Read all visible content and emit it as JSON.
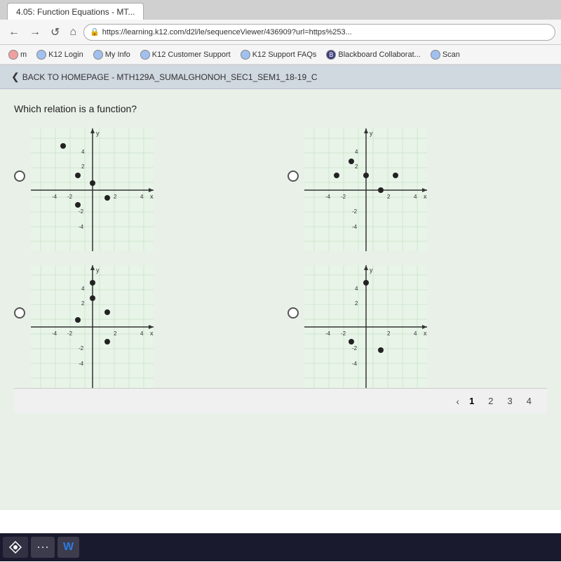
{
  "browser": {
    "tab_label": "4.05: Function Equations - MT...",
    "url": "https://learning.k12.com/d2l/le/sequenceViewer/436909?url=https%253...",
    "nav_back": "←",
    "nav_forward": "→",
    "nav_reload": "↺",
    "nav_home": "⌂"
  },
  "bookmarks": [
    {
      "label": "m",
      "icon": "K12"
    },
    {
      "label": "K12 Login",
      "icon": "K"
    },
    {
      "label": "My Info",
      "icon": "K"
    },
    {
      "label": "K12 Customer Support",
      "icon": "K"
    },
    {
      "label": "K12 Support FAQs",
      "icon": "K"
    },
    {
      "label": "Blackboard Collaborat...",
      "icon": "B"
    },
    {
      "label": "Scan",
      "icon": "K"
    }
  ],
  "breadcrumb": "BACK TO HOMEPAGE - MTH129A_SUMALGHONOH_SEC1_SEM1_18-19_C",
  "question": {
    "text": "Which relation is a function?",
    "options": [
      {
        "id": "A",
        "selected": false
      },
      {
        "id": "B",
        "selected": false
      },
      {
        "id": "C",
        "selected": false
      },
      {
        "id": "D",
        "selected": false
      }
    ]
  },
  "pagination": {
    "back": "‹",
    "pages": [
      "1",
      "2",
      "3",
      "4"
    ],
    "current": "1"
  },
  "taskbar": {
    "start_icon": "❖",
    "app1": "...",
    "app2": "W"
  }
}
